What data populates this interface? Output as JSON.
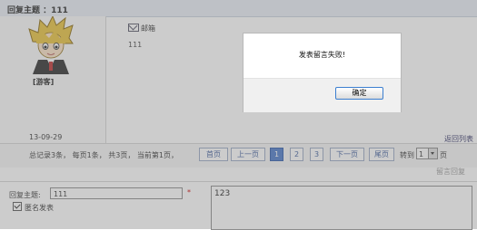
{
  "header": {
    "title": "回复主题 ：111"
  },
  "post": {
    "username": "[游客]",
    "date": "13-09-29",
    "mail_label": "邮箱",
    "content": "111",
    "back_link": "返回列表"
  },
  "pagination": {
    "summary": "总记录3条，  每页1条，  共3页，  当前第1页，",
    "first": "首页",
    "prev": "上一页",
    "pages": [
      "1",
      "2",
      "3"
    ],
    "next": "下一页",
    "last": "尾页",
    "goto_label": "转到",
    "goto_value": "1",
    "goto_suffix": "页"
  },
  "reply_hint": "留言回复",
  "form": {
    "subject_label": "回复主题:",
    "subject_value": "111",
    "required_mark": "*",
    "anonymous_label": "匿名发表",
    "content_value": "123"
  },
  "dialog": {
    "message": "发表留言失败!",
    "ok_label": "确定"
  },
  "colors": {
    "overlay": "#787878",
    "ok_border": "#3c7fd0",
    "active_page": "#4a78c8"
  }
}
